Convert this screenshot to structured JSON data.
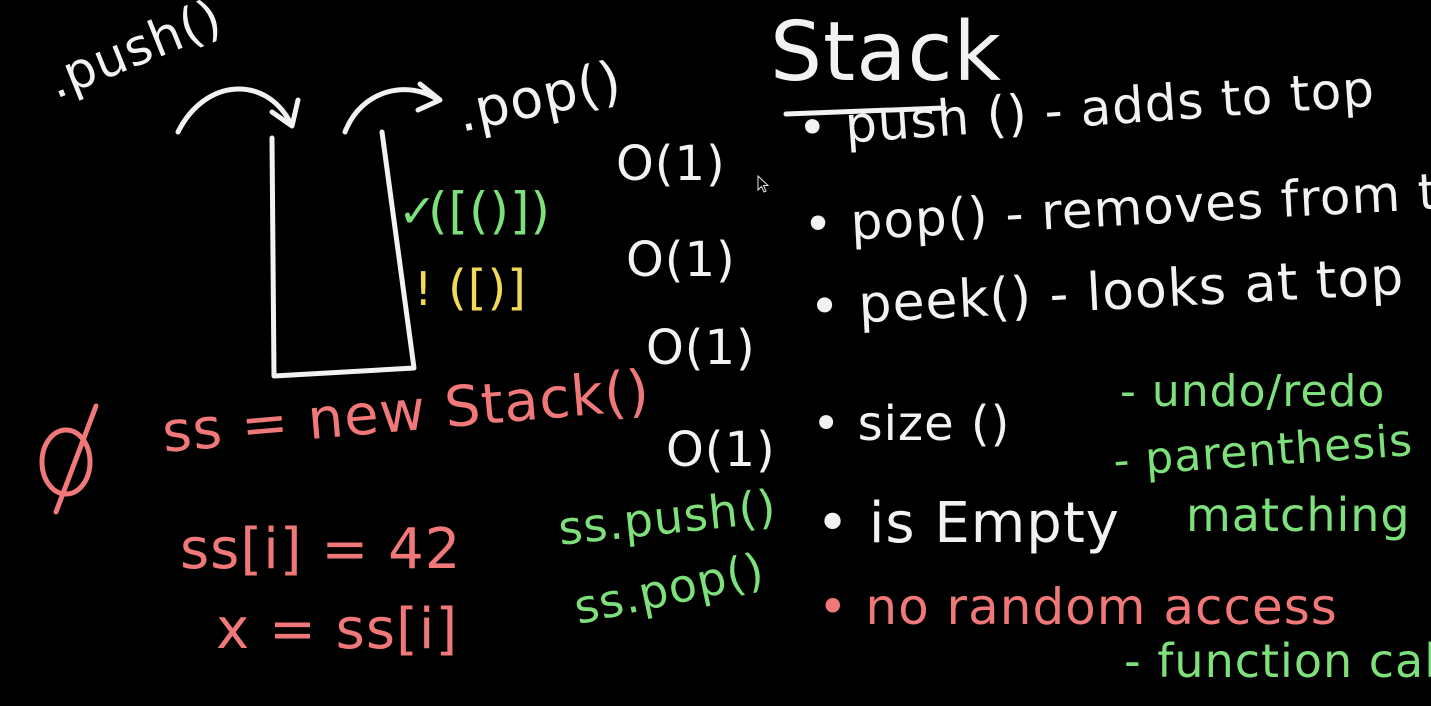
{
  "board": {
    "title": "Stack",
    "push_label": ".push()",
    "pop_label": ".pop()",
    "check_mark": "✓",
    "balanced_example": "([()])",
    "warn_mark": "!",
    "unbalanced_example": "([)]",
    "null_symbol": "Ø",
    "code_lines": [
      "ss = new Stack()",
      "ss[i] = 42",
      "x = ss[i]"
    ],
    "green_calls": [
      "ss.push()",
      "ss.pop()"
    ],
    "operations": [
      {
        "complexity": "O(1)",
        "text": "• push () - adds to top"
      },
      {
        "complexity": "O(1)",
        "text": "• pop() - removes from top"
      },
      {
        "complexity": "O(1)",
        "text": "• peek() - looks at top"
      },
      {
        "complexity": "O(1)",
        "text": "• size ()"
      },
      {
        "complexity": "",
        "text": "• is Empty"
      }
    ],
    "no_random_access": "• no random access",
    "uses": [
      "- undo/redo",
      "- parenthesis",
      "matching",
      "- function calls"
    ],
    "colors": {
      "background": "#000000",
      "chalk_white": "#f2f2f2",
      "chalk_green": "#7de07a",
      "chalk_red": "#f07878",
      "chalk_yellow": "#f3d95a"
    }
  }
}
